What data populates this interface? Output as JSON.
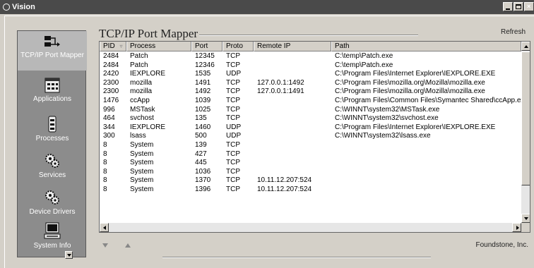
{
  "window": {
    "title": "Vision"
  },
  "sidebar": {
    "items": [
      {
        "label": "TCP/IP Port Mapper",
        "icon": "port-mapper-icon",
        "active": true
      },
      {
        "label": "Applications",
        "icon": "applications-icon"
      },
      {
        "label": "Processes",
        "icon": "processes-icon"
      },
      {
        "label": "Services",
        "icon": "services-icon"
      },
      {
        "label": "Device Drivers",
        "icon": "device-drivers-icon"
      },
      {
        "label": "System Info",
        "icon": "system-info-icon"
      }
    ]
  },
  "main": {
    "title": "TCP/IP Port Mapper",
    "refresh_label": "Refresh",
    "columns": [
      "PID",
      "Process",
      "Port",
      "Proto",
      "Remote IP",
      "Path"
    ],
    "rows": [
      [
        "2484",
        "Patch",
        "12345",
        "TCP",
        "",
        "C:\\temp\\Patch.exe"
      ],
      [
        "2484",
        "Patch",
        "12346",
        "TCP",
        "",
        "C:\\temp\\Patch.exe"
      ],
      [
        "2420",
        "IEXPLORE",
        "1535",
        "UDP",
        "",
        "C:\\Program Files\\Internet Explorer\\IEXPLORE.EXE"
      ],
      [
        "2300",
        "mozilla",
        "1491",
        "TCP",
        "127.0.0.1:1492",
        "C:\\Program Files\\mozilla.org\\Mozilla\\mozilla.exe"
      ],
      [
        "2300",
        "mozilla",
        "1492",
        "TCP",
        "127.0.0.1:1491",
        "C:\\Program Files\\mozilla.org\\Mozilla\\mozilla.exe"
      ],
      [
        "1476",
        "ccApp",
        "1039",
        "TCP",
        "",
        "C:\\Program Files\\Common Files\\Symantec Shared\\ccApp.exe"
      ],
      [
        "996",
        "MSTask",
        "1025",
        "TCP",
        "",
        "C:\\WINNT\\system32\\MSTask.exe"
      ],
      [
        "464",
        "svchost",
        "135",
        "TCP",
        "",
        "C:\\WINNT\\system32\\svchost.exe"
      ],
      [
        "344",
        "IEXPLORE",
        "1460",
        "UDP",
        "",
        "C:\\Program Files\\Internet Explorer\\IEXPLORE.EXE"
      ],
      [
        "300",
        "lsass",
        "500",
        "UDP",
        "",
        "C:\\WINNT\\system32\\lsass.exe"
      ],
      [
        "8",
        "System",
        "139",
        "TCP",
        "",
        ""
      ],
      [
        "8",
        "System",
        "427",
        "TCP",
        "",
        ""
      ],
      [
        "8",
        "System",
        "445",
        "TCP",
        "",
        ""
      ],
      [
        "8",
        "System",
        "1036",
        "TCP",
        "",
        ""
      ],
      [
        "8",
        "System",
        "1370",
        "TCP",
        "10.11.12.207:524",
        ""
      ],
      [
        "8",
        "System",
        "1396",
        "TCP",
        "10.11.12.207:524",
        ""
      ]
    ]
  },
  "footer": {
    "vendor": "Foundstone, Inc."
  },
  "colors": {
    "sidebar": "#8c8c8c",
    "titlebar": "#4a4a4a",
    "background": "#d4d0c8"
  }
}
